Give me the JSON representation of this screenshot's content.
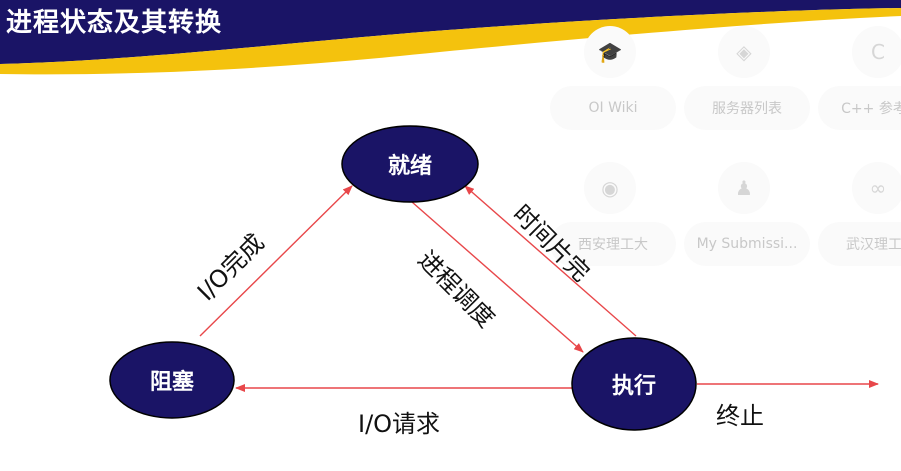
{
  "title": "进程状态及其转换",
  "nodes": {
    "ready": "就绪",
    "blocked": "阻塞",
    "running": "执行"
  },
  "edges": {
    "io_complete": "I/O完成",
    "scheduling": "进程调度",
    "time_slice": "时间片完",
    "io_request": "I/O请求",
    "terminate": "终止"
  },
  "background_tiles": [
    {
      "label": "OI Wiki",
      "icon": "graduation-cap-icon"
    },
    {
      "label": "服务器列表",
      "icon": "server-icon"
    },
    {
      "label": "C++ 参考手",
      "icon": "cpp-icon"
    },
    {
      "label": "西安理工大",
      "icon": "university-logo-icon"
    },
    {
      "label": "My Submissi...",
      "icon": "submission-icon"
    },
    {
      "label": "武汉理工大",
      "icon": "university-logo-icon"
    }
  ],
  "colors": {
    "header_navy": "#1a1466",
    "header_gold": "#f4c20d",
    "node_fill": "#1a1466",
    "arrow": "#e8474a"
  }
}
